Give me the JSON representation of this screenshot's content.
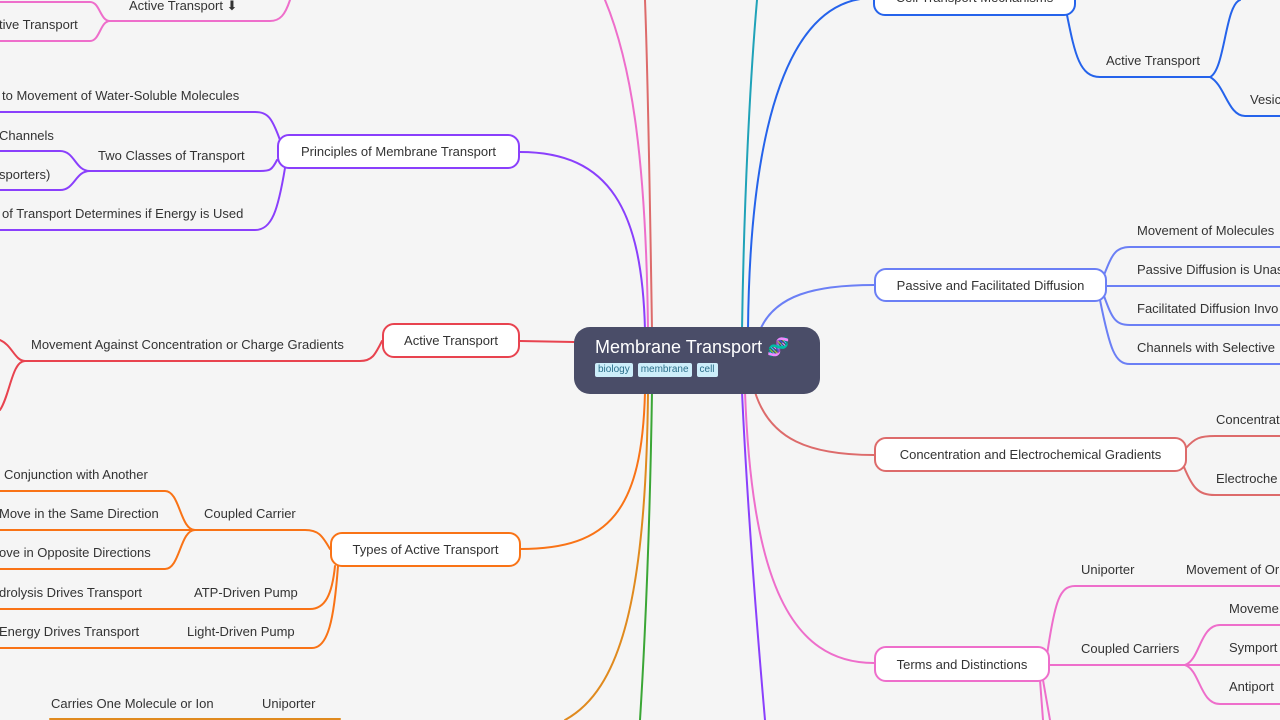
{
  "colors": {
    "principles": "#8a3ffc",
    "active": "#e8434f",
    "types": "#f97316",
    "cell": "#2563eb",
    "passive": "#6b7ff5",
    "gradients": "#dd6b6b",
    "terms": "#ee6ecb",
    "uniporter_branch": "#e08a1e",
    "green": "#3aa635",
    "teal": "#1fa2b8"
  },
  "center": {
    "title": "Membrane Transport",
    "icon": "dna-icon",
    "tags": [
      "biology",
      "membrane",
      "cell"
    ]
  },
  "top_left": {
    "parent": "Active Transport ⬇",
    "child": "tive Transport"
  },
  "principles": {
    "label": "Principles of Membrane Transport",
    "children": [
      "to Movement of Water-Soluble Molecules",
      "Two Classes of Transport",
      "of Transport Determines if Energy is Used"
    ],
    "two_classes_children": [
      "Channels",
      "sporters)"
    ]
  },
  "active": {
    "label": "Active Transport",
    "child": "Movement Against Concentration or Charge Gradients"
  },
  "types": {
    "label": "Types of Active Transport",
    "coupled": "Coupled Carrier",
    "coupled_children": [
      "Conjunction with Another",
      "Move in the Same Direction",
      "ove in Opposite Directions"
    ],
    "atp": "ATP-Driven Pump",
    "atp_child": "drolysis Drives Transport",
    "light": "Light-Driven Pump",
    "light_child": "Energy Drives Transport"
  },
  "bottom_left": {
    "uniporter": "Uniporter",
    "uniporter_child": "Carries One Molecule or Ion"
  },
  "cell": {
    "label": "Cell Transport Mechanisms",
    "active": "Active Transport",
    "vesic": "Vesic"
  },
  "passive": {
    "label": "Passive and Facilitated Diffusion",
    "children": [
      "Movement of Molecules",
      "Passive Diffusion is Unas",
      "Facilitated Diffusion Invo",
      "Channels with Selective"
    ]
  },
  "gradients": {
    "label": "Concentration and Electrochemical Gradients",
    "children": [
      "Concentrat",
      "Electroche"
    ]
  },
  "terms": {
    "label": "Terms and Distinctions",
    "uniporter": "Uniporter",
    "uniporter_child": "Movement of Or",
    "coupled": "Coupled Carriers",
    "coupled_children": [
      "Moveme",
      "Symport",
      "Antiport"
    ]
  }
}
